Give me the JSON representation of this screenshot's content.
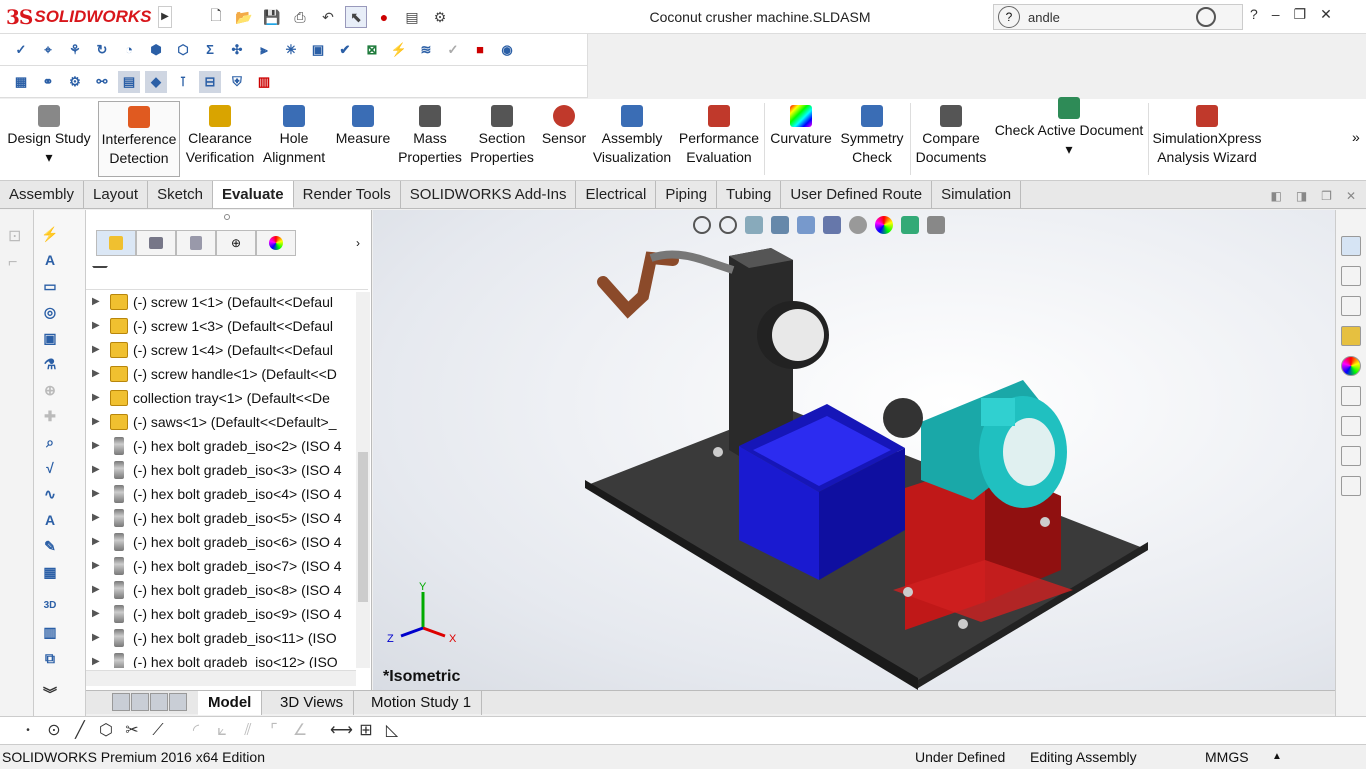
{
  "app": {
    "brand_ds": "3S",
    "brand": "SOLIDWORKS",
    "window_title": "Coconut crusher machine.SLDASM"
  },
  "search": {
    "value": "andle"
  },
  "ribbon": [
    {
      "label": "Design Study",
      "color": "#555555"
    },
    {
      "label": "Interference Detection",
      "color": "#e05a20"
    },
    {
      "label": "Clearance Verification",
      "color": "#d9a400"
    },
    {
      "label": "Hole Alignment",
      "color": "#3a6db5"
    },
    {
      "label": "Measure",
      "color": "#3a6db5"
    },
    {
      "label": "Mass Properties",
      "color": "#555555"
    },
    {
      "label": "Section Properties",
      "color": "#555555"
    },
    {
      "label": "Sensor",
      "color": "#c0392b"
    },
    {
      "label": "Assembly Visualization",
      "color": "#3a6db5"
    },
    {
      "label": "Performance Evaluation",
      "color": "#c0392b"
    },
    {
      "label": "Curvature",
      "color": "#8e44ad"
    },
    {
      "label": "Symmetry Check",
      "color": "#3a6db5"
    },
    {
      "label": "Compare Documents",
      "color": "#555555"
    },
    {
      "label": "Check Active Document",
      "color": "#2e8b57"
    },
    {
      "label": "SimulationXpress Analysis Wizard",
      "color": "#c0392b"
    }
  ],
  "tabs": [
    "Assembly",
    "Layout",
    "Sketch",
    "Evaluate",
    "Render Tools",
    "SOLIDWORKS Add-Ins",
    "Electrical",
    "Piping",
    "Tubing",
    "User Defined Route",
    "Simulation"
  ],
  "tree": [
    {
      "label": "(-) screw 1<1> (Default<<Defaul",
      "type": "component"
    },
    {
      "label": "(-) screw 1<3> (Default<<Defaul",
      "type": "component"
    },
    {
      "label": "(-) screw 1<4> (Default<<Defaul",
      "type": "component"
    },
    {
      "label": "(-) screw handle<1> (Default<<D",
      "type": "component"
    },
    {
      "label": "collection tray<1> (Default<<De",
      "type": "component"
    },
    {
      "label": "(-) saws<1> (Default<<Default>_",
      "type": "component"
    },
    {
      "label": "(-) hex bolt gradeb_iso<2> (ISO 4",
      "type": "bolt"
    },
    {
      "label": "(-) hex bolt gradeb_iso<3> (ISO 4",
      "type": "bolt"
    },
    {
      "label": "(-) hex bolt gradeb_iso<4> (ISO 4",
      "type": "bolt"
    },
    {
      "label": "(-) hex bolt gradeb_iso<5> (ISO 4",
      "type": "bolt"
    },
    {
      "label": "(-) hex bolt gradeb_iso<6> (ISO 4",
      "type": "bolt"
    },
    {
      "label": "(-) hex bolt gradeb_iso<7> (ISO 4",
      "type": "bolt"
    },
    {
      "label": "(-) hex bolt gradeb_iso<8> (ISO 4",
      "type": "bolt"
    },
    {
      "label": "(-) hex bolt gradeb_iso<9> (ISO 4",
      "type": "bolt"
    },
    {
      "label": "(-) hex bolt gradeb_iso<11> (ISO",
      "type": "bolt"
    },
    {
      "label": "(-) hex bolt gradeb_iso<12> (ISO",
      "type": "bolt"
    }
  ],
  "viewport": {
    "view_name": "*Isometric",
    "axis_x": "X",
    "axis_y": "Y",
    "axis_z": "Z"
  },
  "bottom_tabs": [
    "Model",
    "3D Views",
    "Motion Study 1"
  ],
  "status": {
    "edition": "SOLIDWORKS Premium 2016 x64 Edition",
    "definition": "Under Defined",
    "mode": "Editing Assembly",
    "units": "MMGS"
  },
  "colors": {
    "base_plate": "#3a3a3a",
    "tray": "#1a1ad0",
    "motor": "#20c0c0",
    "motor_stand": "#c01818",
    "handle": "#8b4a2a",
    "column": "#2a2a2a"
  }
}
